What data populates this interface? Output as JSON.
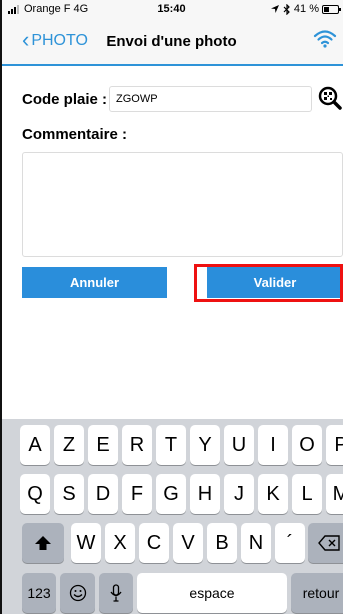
{
  "status_bar": {
    "carrier": "Orange F",
    "network": "4G",
    "time": "15:40",
    "battery_text": "41 %",
    "battery_level": 0.41
  },
  "navbar": {
    "back_label": "PHOTO",
    "title": "Envoi d'une photo",
    "accent": "#2e93d8"
  },
  "form": {
    "plate_label": "Code plaie :",
    "plate_value": "ZGOWP",
    "comment_label": "Commentaire :",
    "comment_value": ""
  },
  "buttons": {
    "cancel": "Annuler",
    "validate": "Valider",
    "color": "#2a8edb",
    "highlight_color": "#e11111"
  },
  "keyboard": {
    "row1": [
      "A",
      "Z",
      "E",
      "R",
      "T",
      "Y",
      "U",
      "I",
      "O",
      "P"
    ],
    "row2": [
      "Q",
      "S",
      "D",
      "F",
      "G",
      "H",
      "J",
      "K",
      "L",
      "M"
    ],
    "row3": [
      "W",
      "X",
      "C",
      "V",
      "B",
      "N",
      "´"
    ],
    "numbers_key": "123",
    "space_key": "espace",
    "return_key": "retour",
    "icons": [
      "shift-icon",
      "backspace-icon",
      "emoji-icon",
      "microphone-icon"
    ]
  }
}
